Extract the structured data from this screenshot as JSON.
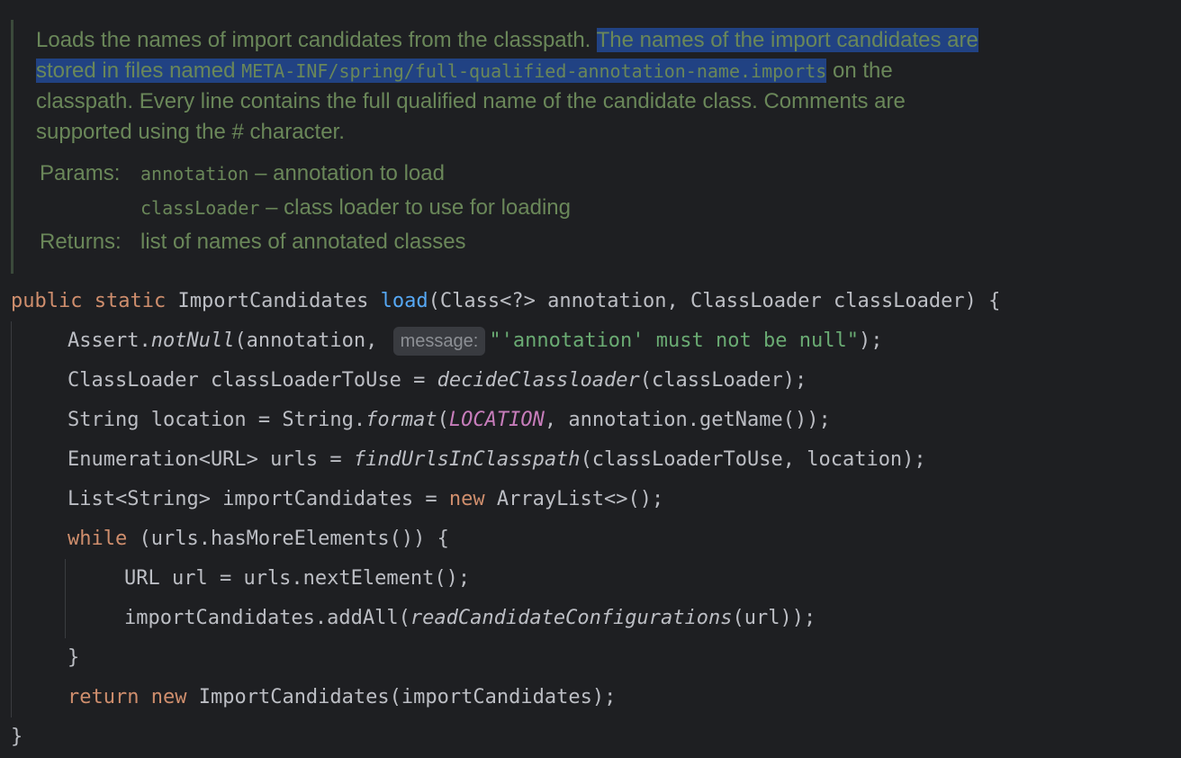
{
  "doc": {
    "line1_a": "Loads the names of import candidates from the classpath.",
    "line1_sel": "The names of the import candidates are",
    "line2_sel_a": "stored in files named",
    "line2_sel_code": "META-INF/spring/full-qualified-annotation-name.imports",
    "line2_b": "on the",
    "line3": "classpath. Every line contains the full qualified name of the candidate class. Comments are",
    "line4": "supported using the # character.",
    "params_label": "Params:",
    "param1_name": "annotation",
    "param1_desc": "– annotation to load",
    "param2_name": "classLoader",
    "param2_desc": "– class loader to use for loading",
    "returns_label": "Returns:",
    "returns_desc": "list of names of annotated classes"
  },
  "code": {
    "sig": {
      "kw1": "public",
      "kw2": "static",
      "type": "ImportCandidates",
      "name": "load",
      "args": "(Class<?> annotation, ClassLoader classLoader) {"
    },
    "l1": {
      "a": "Assert.",
      "b": "notNull",
      "c": "(annotation,",
      "hint": "message:",
      "str": "\"'annotation' must not be null\"",
      "d": ");"
    },
    "l2": {
      "a": "ClassLoader classLoaderToUse = ",
      "b": "decideClassloader",
      "c": "(classLoader);"
    },
    "l3": {
      "a": "String location = String.",
      "b": "format",
      "c": "(",
      "const": "LOCATION",
      "d": ", annotation.getName());"
    },
    "l4": {
      "a": "Enumeration<URL> urls = ",
      "b": "findUrlsInClasspath",
      "c": "(classLoaderToUse, location);"
    },
    "l5": {
      "a": "List<String> importCandidates = ",
      "kw": "new",
      "b": " ArrayList<>();"
    },
    "l6": {
      "kw": "while",
      "a": " (urls.hasMoreElements()) {"
    },
    "l7": {
      "a": "URL url = urls.nextElement();"
    },
    "l8": {
      "a": "importCandidates.addAll(",
      "b": "readCandidateConfigurations",
      "c": "(url));"
    },
    "l9": {
      "a": "}"
    },
    "l10": {
      "kw1": "return",
      "kw2": "new",
      "a": " ImportCandidates(importCandidates);"
    },
    "l11": {
      "a": "}"
    }
  },
  "colors": {
    "background": "#1e1f22",
    "doc_text": "#6a8759",
    "selection": "#214283",
    "keyword": "#cf8e6d",
    "function": "#56a8f5",
    "constant": "#c77dbb",
    "string": "#6aab73"
  }
}
